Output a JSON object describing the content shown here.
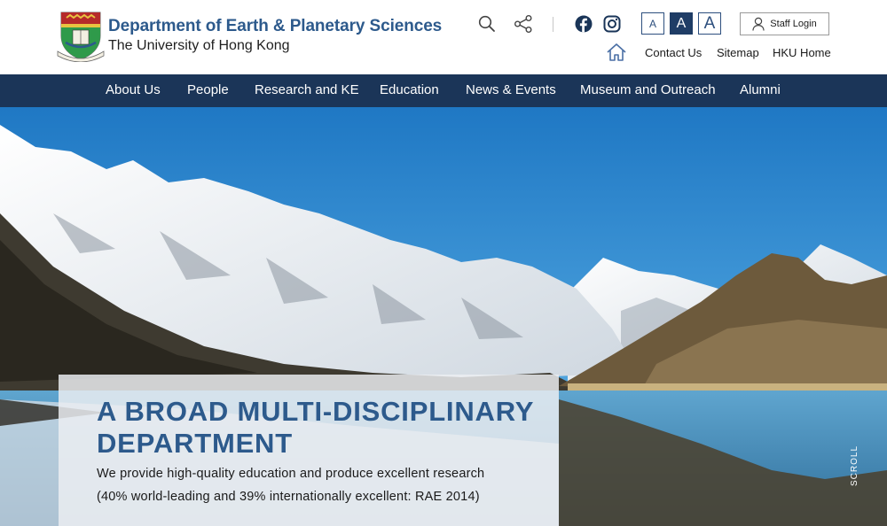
{
  "header": {
    "department_name": "Department of Earth & Planetary Sciences",
    "university_name": "The University of Hong Kong",
    "logo_icon": "hku-crest-icon",
    "icons": {
      "search": "search-icon",
      "share": "share-icon",
      "facebook": "facebook-icon",
      "instagram": "instagram-icon",
      "home": "home-icon",
      "user": "user-icon"
    },
    "font_size_options": [
      "A",
      "A",
      "A"
    ],
    "font_size_selected_index": 1,
    "staff_login_label": "Staff Login",
    "links": {
      "contact": "Contact Us",
      "sitemap": "Sitemap",
      "hku_home": "HKU Home"
    }
  },
  "nav": {
    "items": [
      "About Us",
      "People",
      "Research and KE",
      "Education",
      "News & Events",
      "Museum and Outreach",
      "Alumni"
    ]
  },
  "hero": {
    "title": "A BROAD MULTI-DISCIPLINARY DEPARTMENT",
    "text_line_1": "We provide high-quality education and produce excellent research",
    "text_line_2": "(40% world-leading and 39% internationally excellent: RAE 2014)",
    "scroll_label": "SCROLL"
  },
  "colors": {
    "brand_blue": "#2d5a8c",
    "nav_background": "#1b3558",
    "font_button_active": "#1f3d66",
    "sky": "#3a8fd0"
  }
}
